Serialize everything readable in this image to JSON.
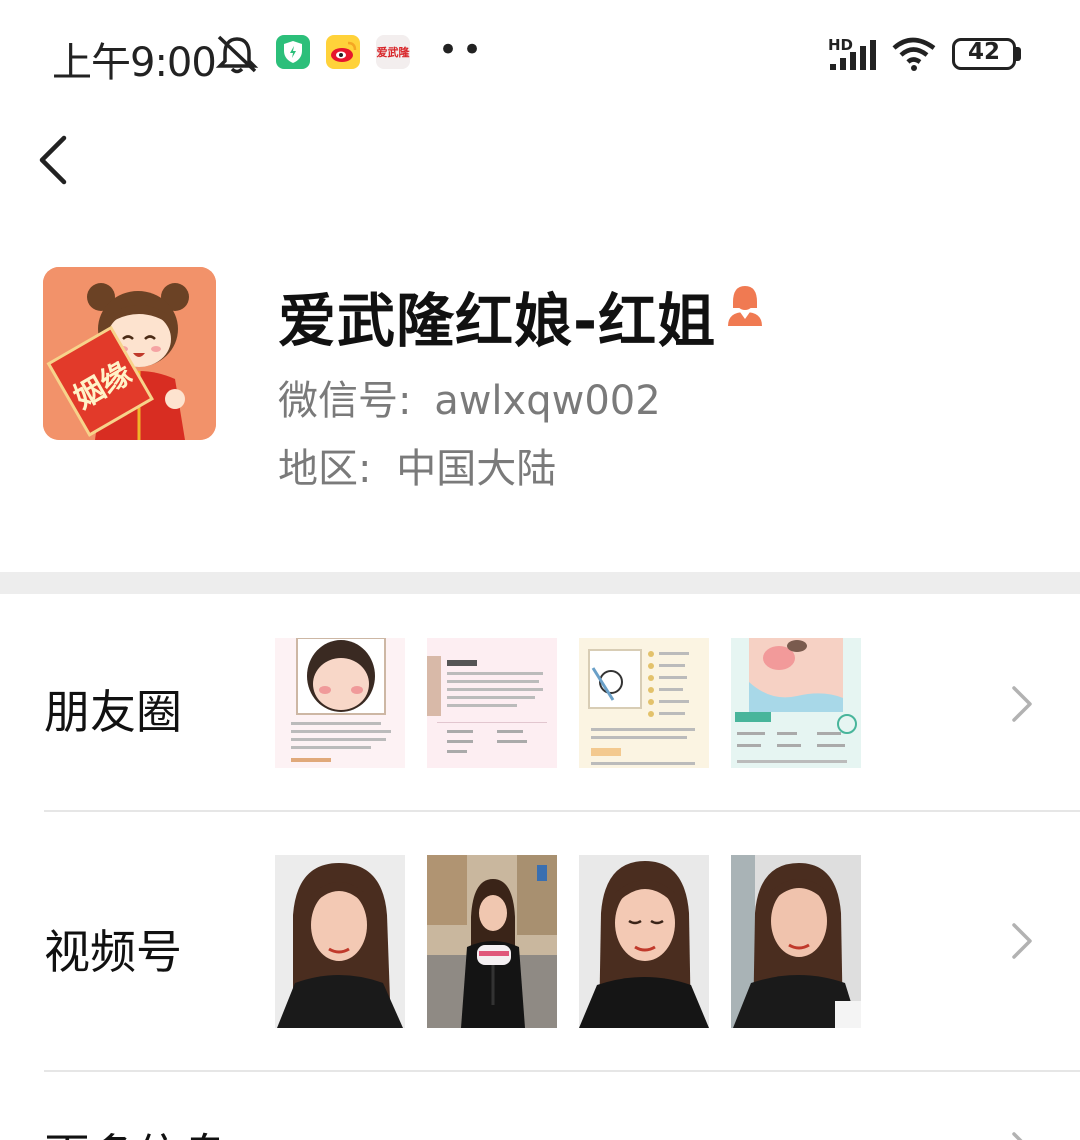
{
  "status_bar": {
    "time": "上午9:00",
    "app_icons": [
      "silent-bell-icon",
      "shield-app-icon",
      "weibo-app-icon",
      "aiwulong-app-icon"
    ],
    "app_badge_text": "爱武隆",
    "more": "••",
    "signal": "HD",
    "battery": "42"
  },
  "profile": {
    "name": "爱武隆红娘-红姐",
    "avatar_text": "姻缘",
    "wechat_id_label": "微信号:",
    "wechat_id": "awlxqw002",
    "region_label": "地区:",
    "region": "中国大陆"
  },
  "rows": {
    "moments": "朋友圈",
    "channels": "视频号",
    "more_info": "更多信息"
  },
  "colors": {
    "accent": "#f07a52",
    "avatar_bg": "#f2926a",
    "secondary_text": "#7a7a7a",
    "divider": "#ededed"
  }
}
